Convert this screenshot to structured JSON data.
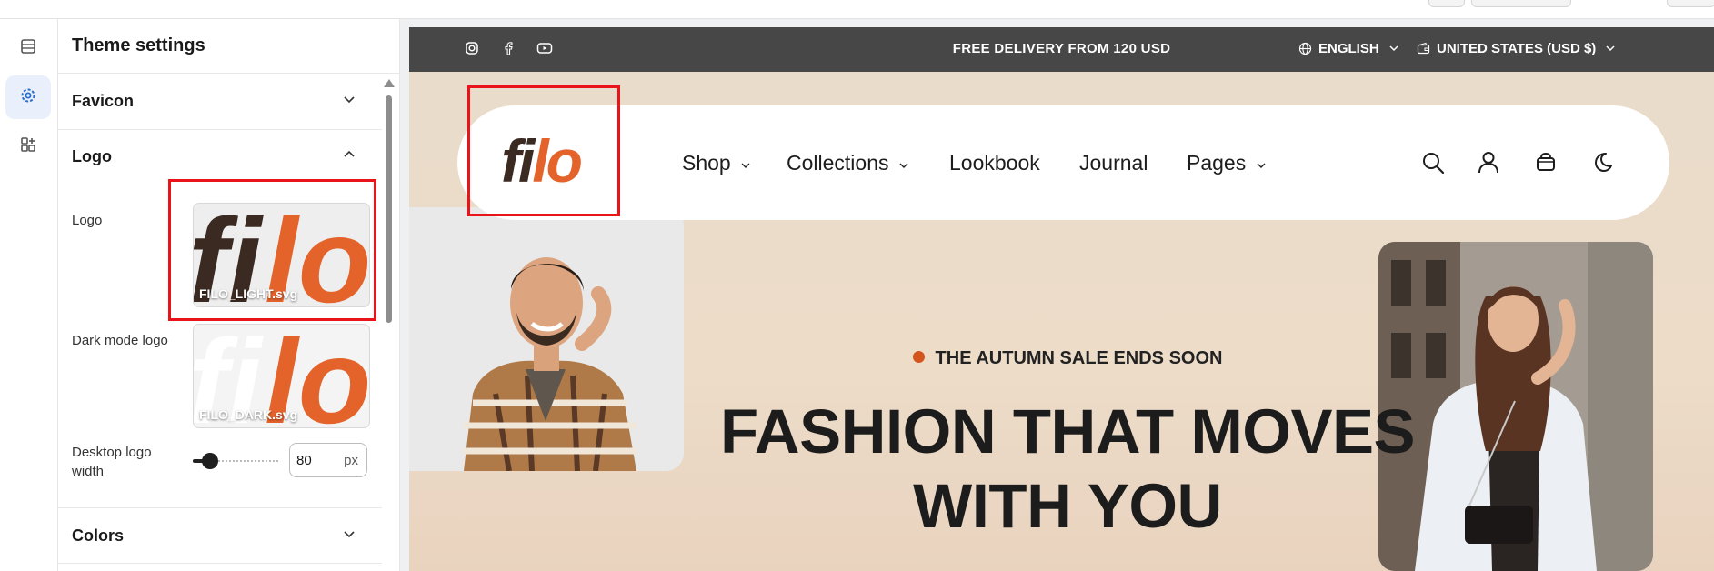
{
  "panel": {
    "title": "Theme settings",
    "sections": {
      "favicon": "Favicon",
      "logo": "Logo",
      "colors": "Colors"
    },
    "logo_fields": {
      "logo_label": "Logo",
      "logo_file": "FILO_LIGHT.svg",
      "dark_label": "Dark mode logo",
      "dark_file": "FILO_DARK.svg",
      "width_label": "Desktop logo width",
      "width_value": "80",
      "width_unit": "px",
      "width_slider_fraction": 0.08
    }
  },
  "rail": {
    "icons": [
      "sections-icon",
      "theme-settings-gear-icon",
      "apps-icon"
    ],
    "active": "theme-settings-gear-icon"
  },
  "store": {
    "announcement": "FREE DELIVERY FROM 120 USD",
    "language": "ENGLISH",
    "currency": "UNITED STATES (USD $)",
    "social_icons": [
      "instagram-icon",
      "facebook-icon",
      "youtube-icon"
    ],
    "logo_text": {
      "part1": "fi",
      "part2": "lo"
    },
    "nav": {
      "shop": "Shop",
      "collections": "Collections",
      "lookbook": "Lookbook",
      "journal": "Journal",
      "pages": "Pages"
    },
    "header_icons": [
      "search-icon",
      "account-icon",
      "cart-icon",
      "dark-mode-icon"
    ],
    "promo": "THE AUTUMN SALE ENDS SOON",
    "headline_1": "FASHION THAT MOVES",
    "headline_2": "WITH YOU"
  },
  "colors": {
    "accent": "#d3541c",
    "logo_dark": "#3b2a22",
    "logo_orange": "#e3632b",
    "announcement_bg": "#474747",
    "highlight": "#e8141a"
  }
}
